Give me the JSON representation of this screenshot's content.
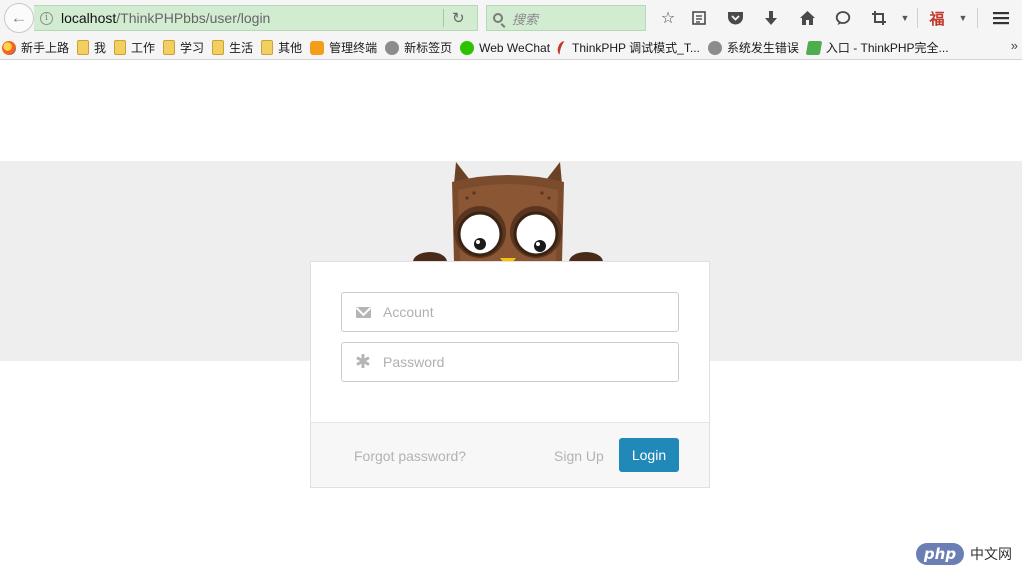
{
  "browser": {
    "url_host": "localhost",
    "url_path": "/ThinkPHPbbs/user/login",
    "search_placeholder": "搜索",
    "bookmarks": [
      {
        "label": "新手上路",
        "icon": "firefox-icon"
      },
      {
        "label": "我",
        "icon": "folder-icon"
      },
      {
        "label": "工作",
        "icon": "folder-icon"
      },
      {
        "label": "学习",
        "icon": "folder-icon"
      },
      {
        "label": "生活",
        "icon": "folder-icon"
      },
      {
        "label": "其他",
        "icon": "folder-icon"
      },
      {
        "label": "管理终端",
        "icon": "orange-app-icon"
      },
      {
        "label": "新标签页",
        "icon": "globe-icon"
      },
      {
        "label": "Web WeChat",
        "icon": "wechat-icon"
      },
      {
        "label": "ThinkPHP 调试模式_T...",
        "icon": "thinkphp-icon"
      },
      {
        "label": "系统发生错误",
        "icon": "globe-icon"
      },
      {
        "label": "入口 - ThinkPHP完全...",
        "icon": "leaf-icon"
      }
    ],
    "bookmarks_overflow": "»"
  },
  "login": {
    "account_placeholder": "Account",
    "password_placeholder": "Password",
    "forgot_label": "Forgot password?",
    "signup_label": "Sign Up",
    "login_label": "Login"
  },
  "colors": {
    "accent": "#2189b8",
    "band": "#eeeeee",
    "urlbar": "#d2ecd2"
  },
  "watermark": {
    "logo_text": "php",
    "site_text": "中文网"
  }
}
